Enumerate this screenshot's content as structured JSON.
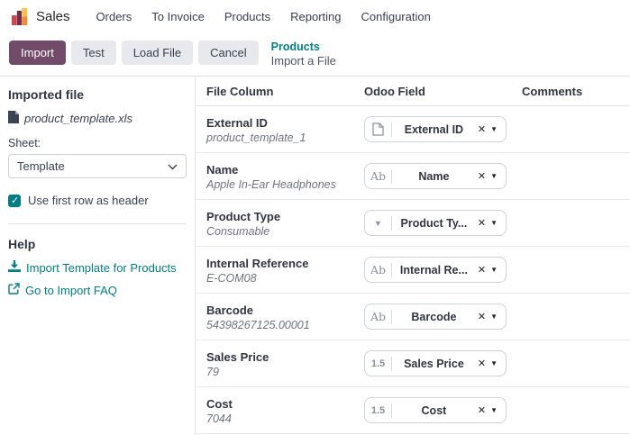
{
  "nav": {
    "app_name": "Sales",
    "items": [
      {
        "label": "Orders"
      },
      {
        "label": "To Invoice"
      },
      {
        "label": "Products"
      },
      {
        "label": "Reporting"
      },
      {
        "label": "Configuration"
      }
    ]
  },
  "control_bar": {
    "buttons": {
      "import": "Import",
      "test": "Test",
      "load_file": "Load File",
      "cancel": "Cancel"
    },
    "breadcrumb": {
      "parent": "Products",
      "current": "Import a File"
    }
  },
  "sidebar": {
    "imported_file_heading": "Imported file",
    "file_name": "product_template.xls",
    "sheet_label": "Sheet:",
    "sheet_value": "Template",
    "first_row_header_label": "Use first row as header",
    "first_row_header_checked": true,
    "help_heading": "Help",
    "links": [
      {
        "label": "Import Template for Products",
        "icon": "download-icon"
      },
      {
        "label": "Go to Import FAQ",
        "icon": "external-link-icon"
      }
    ]
  },
  "table": {
    "headers": [
      "File Column",
      "Odoo Field",
      "Comments"
    ],
    "rows": [
      {
        "column": "External ID",
        "sample": "product_template_1",
        "field": {
          "icon": "page",
          "label": "External ID"
        }
      },
      {
        "column": "Name",
        "sample": "Apple In-Ear Headphones",
        "field": {
          "icon": "Ab",
          "label": "Name"
        }
      },
      {
        "column": "Product Type",
        "sample": "Consumable",
        "field": {
          "icon": "caret",
          "label": "Product Ty..."
        }
      },
      {
        "column": "Internal Reference",
        "sample": "E-COM08",
        "field": {
          "icon": "Ab",
          "label": "Internal Re..."
        }
      },
      {
        "column": "Barcode",
        "sample": "54398267125.00001",
        "field": {
          "icon": "Ab",
          "label": "Barcode"
        }
      },
      {
        "column": "Sales Price",
        "sample": "79",
        "field": {
          "icon": "1.5",
          "label": "Sales Price"
        }
      },
      {
        "column": "Cost",
        "sample": "7044",
        "field": {
          "icon": "1.5",
          "label": "Cost"
        }
      }
    ]
  },
  "icons": {
    "remove": "✕",
    "caret": "▼",
    "dropdown_glyph": "▼"
  },
  "colors": {
    "primary": "#714B67",
    "accent_teal": "#017E84",
    "text": "#374151",
    "muted": "#6c757d",
    "border": "#dee2e6"
  }
}
